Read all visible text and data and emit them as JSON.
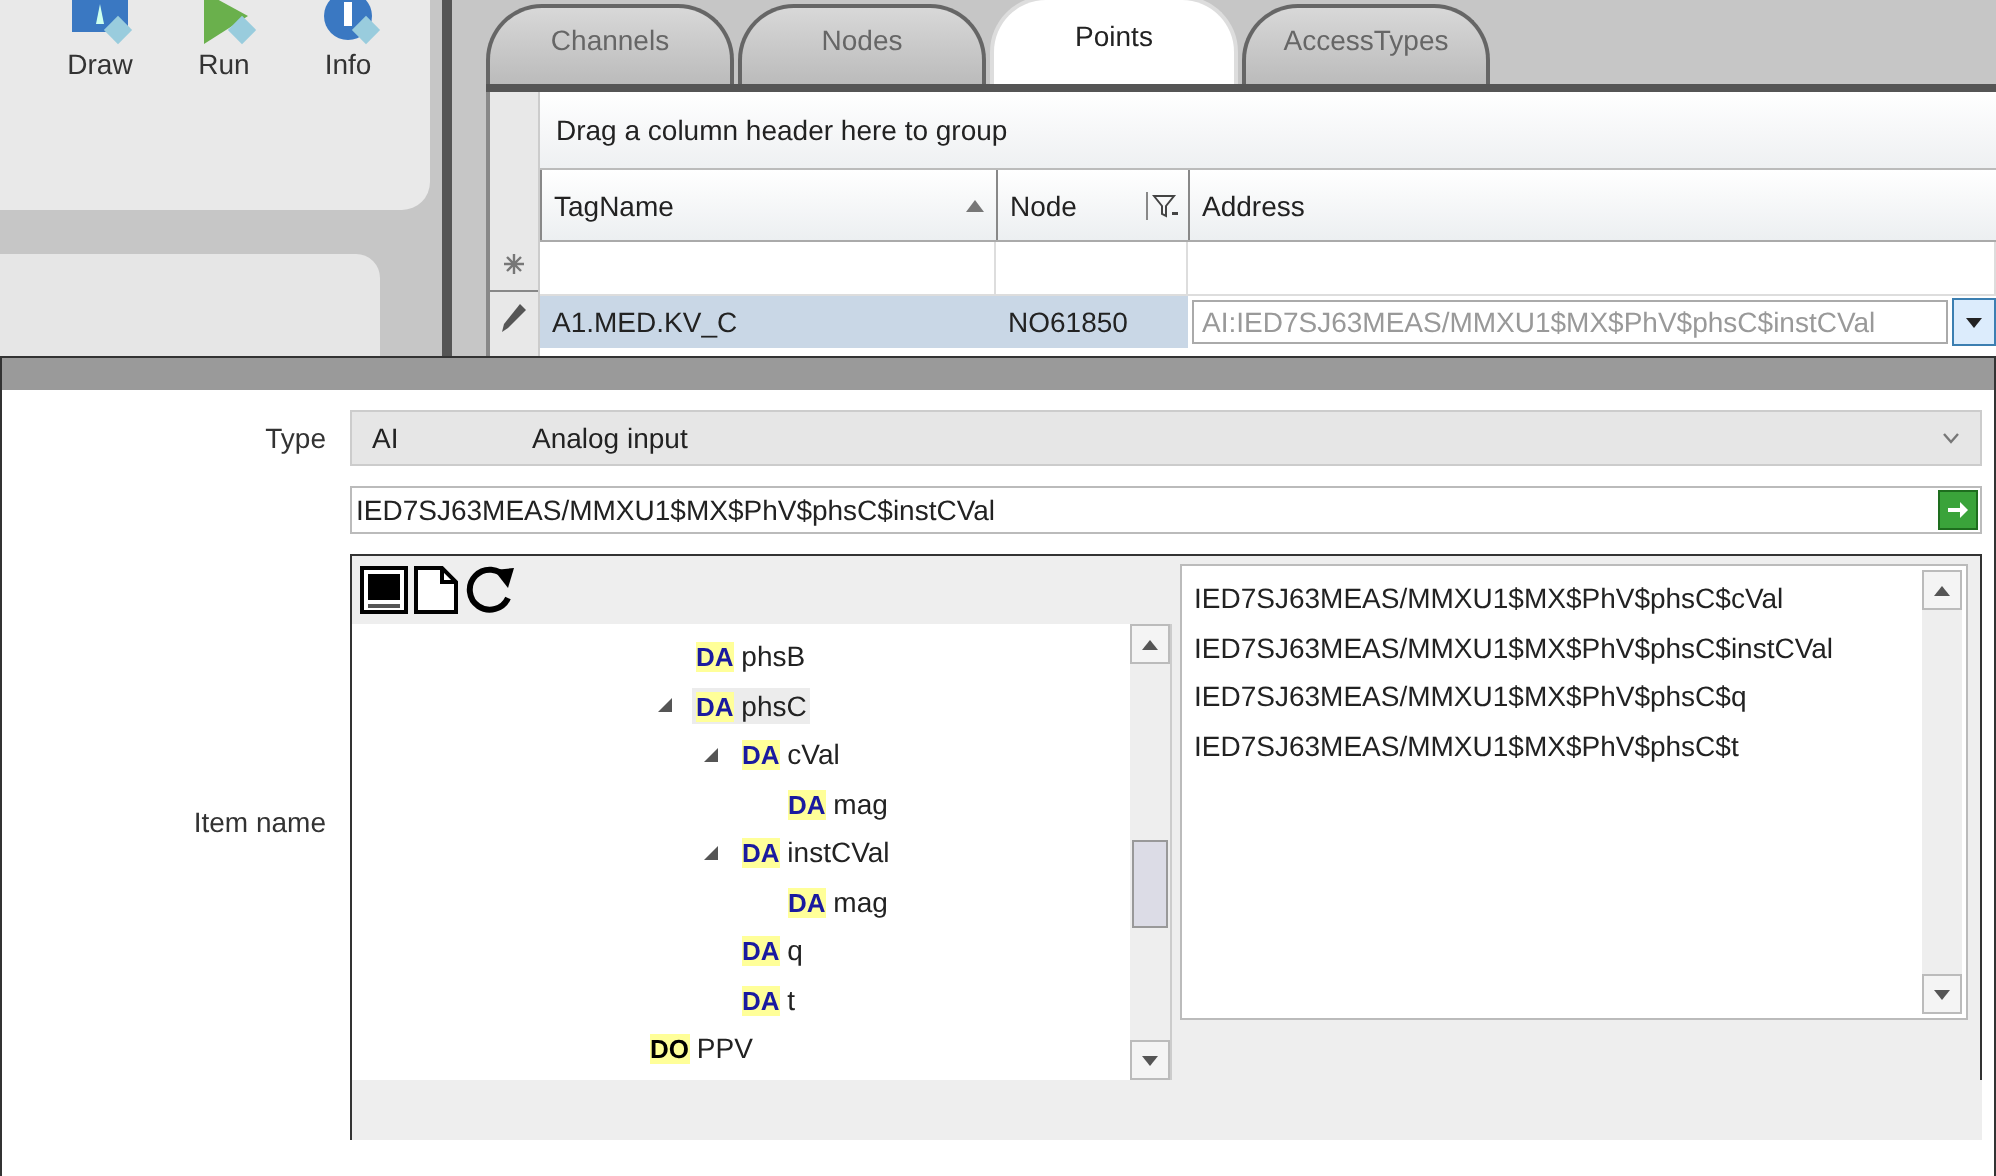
{
  "toolbar": {
    "buttons": [
      {
        "label": "Draw"
      },
      {
        "label": "Run"
      },
      {
        "label": "Info"
      }
    ]
  },
  "tabs": [
    {
      "label": "Channels",
      "selected": false
    },
    {
      "label": "Nodes",
      "selected": false
    },
    {
      "label": "Points",
      "selected": true
    },
    {
      "label": "AccessTypes",
      "selected": false
    }
  ],
  "grid": {
    "group_hint": "Drag a column header here to group",
    "columns": [
      {
        "label": "TagName",
        "sorted": true,
        "filter": false
      },
      {
        "label": "Node",
        "sorted": false,
        "filter": true
      },
      {
        "label": "Address",
        "sorted": false,
        "filter": false
      }
    ],
    "row": {
      "tag_name": "A1.MED.KV_C",
      "node": "NO61850",
      "address": "AI:IED7SJ63MEAS/MMXU1$MX$PhV$phsC$instCVal"
    }
  },
  "editor": {
    "type_label": "Type",
    "type_code": "AI",
    "type_description": "Analog input",
    "path_value": "IED7SJ63MEAS/MMXU1$MX$PhV$phsC$instCVal",
    "item_label": "Item name",
    "tree": [
      {
        "children": [
          {
            "tag": "DA",
            "label": "phsB",
            "selected": false
          },
          {
            "tag": "DA",
            "label": "phsC",
            "selected": true,
            "expanded": true,
            "children": [
              {
                "tag": "DA",
                "label": "cVal",
                "selected": false,
                "expanded": true,
                "children": [
                  {
                    "tag": "DA",
                    "label": "mag",
                    "selected": false
                  }
                ]
              },
              {
                "tag": "DA",
                "label": "instCVal",
                "selected": false,
                "expanded": true,
                "children": [
                  {
                    "tag": "DA",
                    "label": "mag",
                    "selected": false
                  }
                ]
              },
              {
                "tag": "DA",
                "label": "q",
                "selected": false
              },
              {
                "tag": "DA",
                "label": "t",
                "selected": false
              }
            ]
          }
        ]
      },
      {
        "tag": "DO",
        "label": "PPV",
        "selected": false
      }
    ],
    "items": [
      "IED7SJ63MEAS/MMXU1$MX$PhV$phsC$cVal",
      "IED7SJ63MEAS/MMXU1$MX$PhV$phsC$instCVal",
      "IED7SJ63MEAS/MMXU1$MX$PhV$phsC$q",
      "IED7SJ63MEAS/MMXU1$MX$PhV$phsC$t"
    ]
  }
}
